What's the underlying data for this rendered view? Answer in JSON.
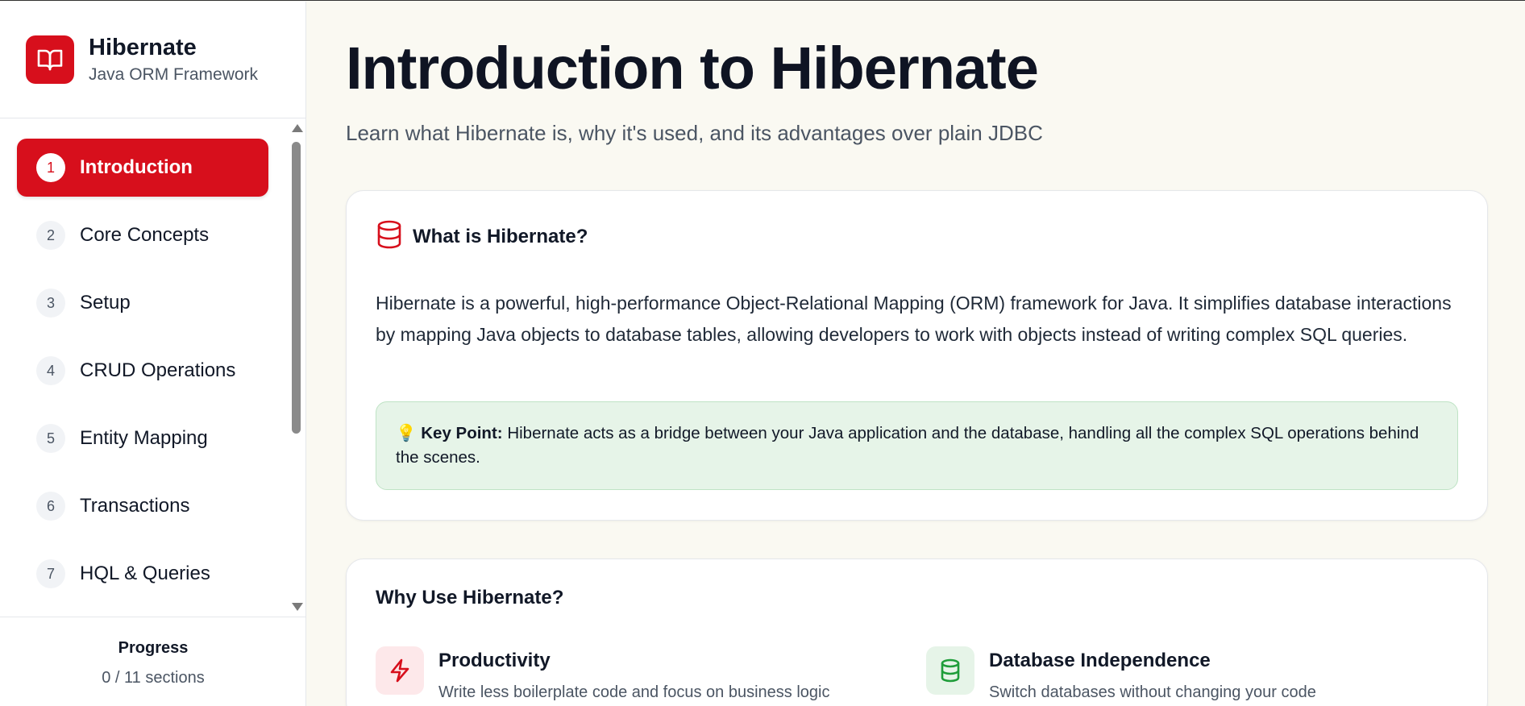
{
  "brand": {
    "title": "Hibernate",
    "subtitle": "Java ORM Framework",
    "icon": "book-open-icon",
    "color": "#d70f1c"
  },
  "sidebar": {
    "items": [
      {
        "num": "1",
        "label": "Introduction",
        "active": true
      },
      {
        "num": "2",
        "label": "Core Concepts",
        "active": false
      },
      {
        "num": "3",
        "label": "Setup",
        "active": false
      },
      {
        "num": "4",
        "label": "CRUD Operations",
        "active": false
      },
      {
        "num": "5",
        "label": "Entity Mapping",
        "active": false
      },
      {
        "num": "6",
        "label": "Transactions",
        "active": false
      },
      {
        "num": "7",
        "label": "HQL & Queries",
        "active": false
      }
    ]
  },
  "progress": {
    "title": "Progress",
    "count": "0 / 11 sections"
  },
  "main": {
    "title": "Introduction to Hibernate",
    "subtitle": "Learn what Hibernate is, why it's used, and its advantages over plain JDBC",
    "what_card": {
      "icon": "database-icon",
      "title": "What is Hibernate?",
      "body": "Hibernate is a powerful, high-performance Object-Relational Mapping (ORM) framework for Java. It simplifies database interactions by mapping Java objects to database tables, allowing developers to work with objects instead of writing complex SQL queries.",
      "keypoint": {
        "icon": "💡",
        "label": "Key Point:",
        "text": "Hibernate acts as a bridge between your Java application and the database, handling all the complex SQL operations behind the scenes."
      }
    },
    "why_card": {
      "title": "Why Use Hibernate?",
      "features": [
        {
          "icon": "lightning-icon",
          "title": "Productivity",
          "desc": "Write less boilerplate code and focus on business logic",
          "accent": "#d70f1c",
          "bg": "#fde8ea"
        },
        {
          "icon": "database-icon",
          "title": "Database Independence",
          "desc": "Switch databases without changing your code",
          "accent": "#1f9d3a",
          "bg": "#e6f4e8"
        }
      ]
    }
  }
}
